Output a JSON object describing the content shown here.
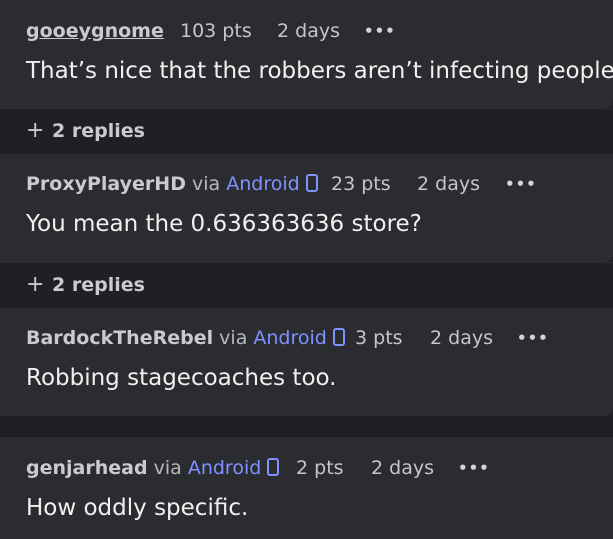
{
  "comments": [
    {
      "user": "gooeygnome",
      "via": "",
      "platform": "",
      "points": "103 pts",
      "time": "2 days",
      "text": "That’s nice that the robbers aren’t infecting people",
      "replies_label": "2 replies"
    },
    {
      "user": "ProxyPlayerHD",
      "via": "via",
      "platform": "Android",
      "points": "23 pts",
      "time": "2 days",
      "text": "You mean the 0.636363636 store?",
      "replies_label": "2 replies"
    },
    {
      "user": "BardockTheRebel",
      "via": "via",
      "platform": "Android",
      "points": "3 pts",
      "time": "2 days",
      "text": "Robbing stagecoaches too."
    },
    {
      "user": "genjarhead",
      "via": "via",
      "platform": "Android",
      "points": "2 pts",
      "time": "2 days",
      "text": "How oddly specific."
    }
  ],
  "icons": {
    "more": "•••",
    "plus": "+",
    "phone": "phone-icon"
  },
  "colors": {
    "background": "#1f2023",
    "card": "#2b2c30",
    "accent": "#7f92ff"
  }
}
